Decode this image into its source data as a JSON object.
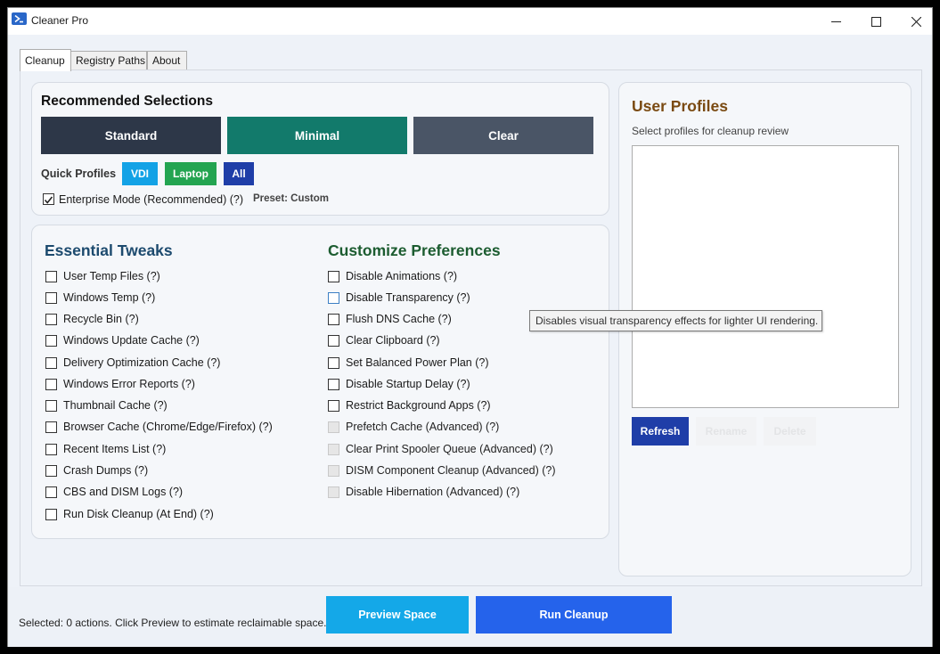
{
  "window": {
    "title": "Cleaner Pro"
  },
  "tabs": [
    {
      "label": "Cleanup"
    },
    {
      "label": "Registry Paths"
    },
    {
      "label": "About"
    }
  ],
  "recommended": {
    "heading": "Recommended Selections",
    "buttons": [
      {
        "label": "Standard",
        "color": "#2d3748"
      },
      {
        "label": "Minimal",
        "color": "#127a6b"
      },
      {
        "label": "Clear",
        "color": "#4a5566"
      }
    ],
    "quick_profiles_label": "Quick Profiles",
    "quick_profiles": [
      {
        "label": "VDI",
        "color": "#13a2e6"
      },
      {
        "label": "Laptop",
        "color": "#23a451"
      },
      {
        "label": "All",
        "color": "#1f3ea8"
      }
    ],
    "enterprise_mode_label": "Enterprise Mode (Recommended) (?)",
    "enterprise_mode_checked": true,
    "preset_label": "Preset: Custom"
  },
  "essential": {
    "heading": "Essential Tweaks",
    "heading_color": "#1c4a6e",
    "items": [
      {
        "label": "User Temp Files (?)"
      },
      {
        "label": "Windows Temp (?)"
      },
      {
        "label": "Recycle Bin (?)"
      },
      {
        "label": "Windows Update Cache (?)"
      },
      {
        "label": "Delivery Optimization Cache (?)"
      },
      {
        "label": "Windows Error Reports (?)"
      },
      {
        "label": "Thumbnail Cache (?)"
      },
      {
        "label": "Browser Cache (Chrome/Edge/Firefox) (?)"
      },
      {
        "label": "Recent Items List (?)"
      },
      {
        "label": "Crash Dumps (?)"
      },
      {
        "label": "CBS and DISM Logs (?)"
      },
      {
        "label": "Run Disk Cleanup (At End) (?)"
      }
    ]
  },
  "customize": {
    "heading": "Customize Preferences",
    "heading_color": "#1c5c30",
    "items": [
      {
        "label": "Disable Animations (?)",
        "state": "normal"
      },
      {
        "label": "Disable Transparency (?)",
        "state": "hover"
      },
      {
        "label": "Flush DNS Cache (?)",
        "state": "normal"
      },
      {
        "label": "Clear Clipboard (?)",
        "state": "normal"
      },
      {
        "label": "Set Balanced Power Plan (?)",
        "state": "normal"
      },
      {
        "label": "Disable Startup Delay (?)",
        "state": "normal"
      },
      {
        "label": "Restrict Background Apps (?)",
        "state": "normal"
      },
      {
        "label": "Prefetch Cache (Advanced) (?)",
        "state": "disabled"
      },
      {
        "label": "Clear Print Spooler Queue (Advanced) (?)",
        "state": "disabled"
      },
      {
        "label": "DISM Component Cleanup (Advanced) (?)",
        "state": "disabled"
      },
      {
        "label": "Disable Hibernation (Advanced) (?)",
        "state": "disabled"
      }
    ]
  },
  "tooltip": {
    "text": "Disables visual transparency effects for lighter UI rendering."
  },
  "user_profiles": {
    "heading": "User Profiles",
    "subtitle": "Select profiles for cleanup review",
    "refresh_label": "Refresh",
    "rename_label": "Rename",
    "delete_label": "Delete"
  },
  "footer": {
    "status": "Selected: 0 actions. Click Preview to estimate reclaimable space.",
    "preview_label": "Preview Space",
    "run_label": "Run Cleanup",
    "preview_color": "#14a8e8",
    "run_color": "#2563eb"
  }
}
